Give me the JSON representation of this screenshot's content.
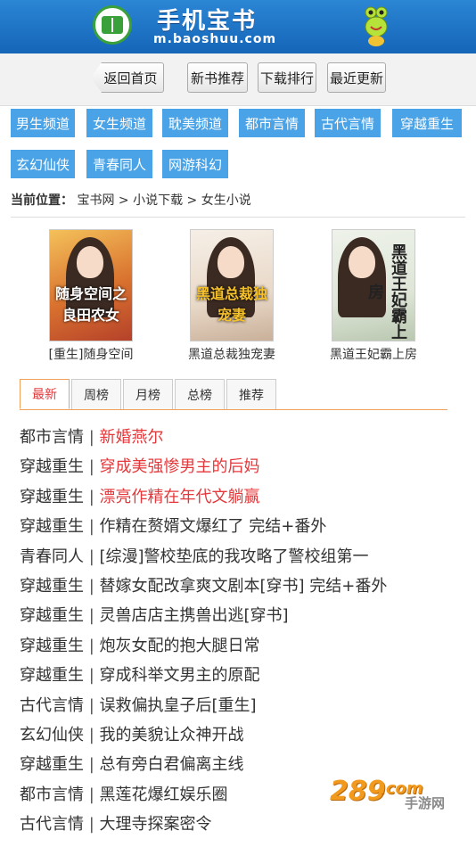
{
  "header": {
    "brand": "手机宝书",
    "domain": "m.baoshuu.com"
  },
  "nav": {
    "back": "返回首页",
    "new_books": "新书推荐",
    "download_rank": "下载排行",
    "recent": "最近更新"
  },
  "categories": [
    "男生频道",
    "女生频道",
    "耽美频道",
    "都市言情",
    "古代言情",
    "穿越重生",
    "玄幻仙侠",
    "青春同人",
    "网游科幻"
  ],
  "breadcrumb": {
    "label": "当前位置：",
    "path": "宝书网 > 小说下载 > 女生小说"
  },
  "books": [
    {
      "title": "[重生]随身空间",
      "cover_text": "随身空间之良田农女"
    },
    {
      "title": "黑道总裁独宠妻",
      "cover_text": "黑道总裁独宠妻"
    },
    {
      "title": "黑道王妃霸上房",
      "cover_text": "黑道王妃霸上房"
    }
  ],
  "tabs": [
    "最新",
    "周榜",
    "月榜",
    "总榜",
    "推荐"
  ],
  "list": [
    {
      "category": "都市言情",
      "title": "新婚燕尔",
      "hot": true
    },
    {
      "category": "穿越重生",
      "title": "穿成美强惨男主的后妈",
      "hot": true
    },
    {
      "category": "穿越重生",
      "title": "漂亮作精在年代文躺赢",
      "hot": true
    },
    {
      "category": "穿越重生",
      "title": "作精在赘婿文爆红了 完结+番外",
      "hot": false
    },
    {
      "category": "青春同人",
      "title": "[综漫]警校垫底的我攻略了警校组第一",
      "hot": false
    },
    {
      "category": "穿越重生",
      "title": "替嫁女配改拿爽文剧本[穿书] 完结+番外",
      "hot": false
    },
    {
      "category": "穿越重生",
      "title": "灵兽店店主携兽出逃[穿书]",
      "hot": false
    },
    {
      "category": "穿越重生",
      "title": "炮灰女配的抱大腿日常",
      "hot": false
    },
    {
      "category": "穿越重生",
      "title": "穿成科举文男主的原配",
      "hot": false
    },
    {
      "category": "古代言情",
      "title": "误救偏执皇子后[重生]",
      "hot": false
    },
    {
      "category": "玄幻仙侠",
      "title": "我的美貌让众神开战",
      "hot": false
    },
    {
      "category": "穿越重生",
      "title": "总有旁白君偏离主线",
      "hot": false
    },
    {
      "category": "都市言情",
      "title": "黑莲花爆红娱乐圈",
      "hot": false
    },
    {
      "category": "古代言情",
      "title": "大理寺探案密令",
      "hot": false
    }
  ],
  "separator": " | ",
  "watermark": {
    "number": "289",
    "suffix": ".com",
    "sub": "手游网"
  },
  "colors": {
    "header": "#1a6fc4",
    "category_bg": "#49a3e6",
    "hot": "#e4393c",
    "tab_border": "#f0a05a"
  }
}
